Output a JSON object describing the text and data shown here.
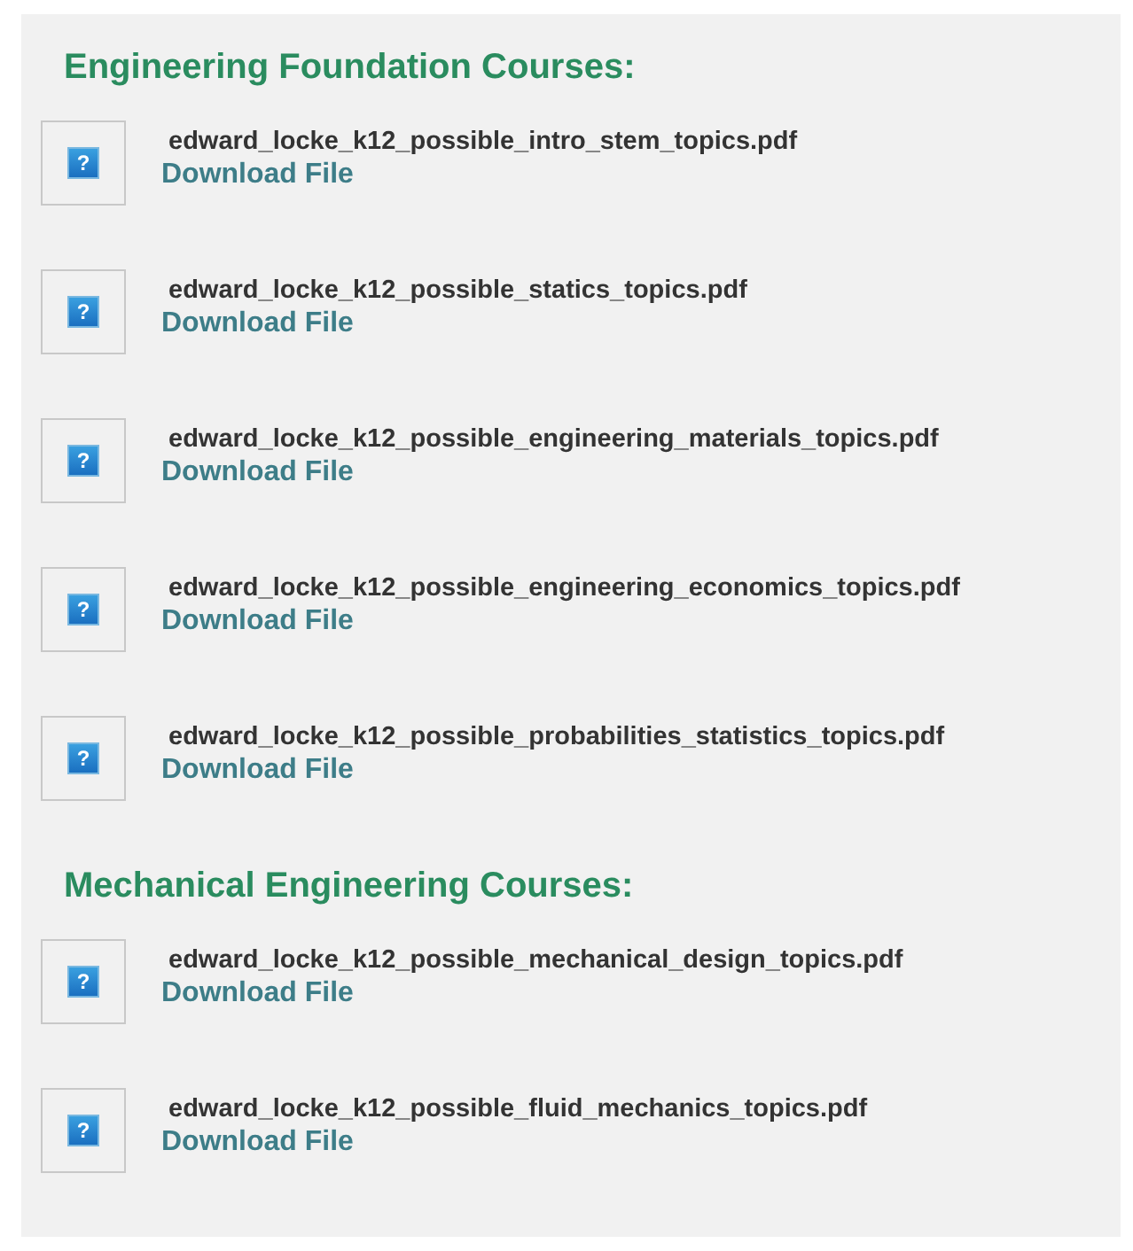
{
  "sections": [
    {
      "heading": "Engineering Foundation Courses:",
      "files": [
        {
          "icon": "?",
          "name": "edward_locke_k12_possible_intro_stem_topics.pdf",
          "link": "Download File"
        },
        {
          "icon": "?",
          "name": "edward_locke_k12_possible_statics_topics.pdf",
          "link": "Download File"
        },
        {
          "icon": "?",
          "name": "edward_locke_k12_possible_engineering_materials_topics.pdf",
          "link": "Download File"
        },
        {
          "icon": "?",
          "name": "edward_locke_k12_possible_engineering_economics_topics.pdf",
          "link": "Download File"
        },
        {
          "icon": "?",
          "name": "edward_locke_k12_possible_probabilities_statistics_topics.pdf",
          "link": "Download File"
        }
      ]
    },
    {
      "heading": "Mechanical Engineering Courses:",
      "files": [
        {
          "icon": "?",
          "name": "edward_locke_k12_possible_mechanical_design_topics.pdf",
          "link": "Download File"
        },
        {
          "icon": "?",
          "name": "edward_locke_k12_possible_fluid_mechanics_topics.pdf",
          "link": "Download File"
        }
      ]
    }
  ]
}
